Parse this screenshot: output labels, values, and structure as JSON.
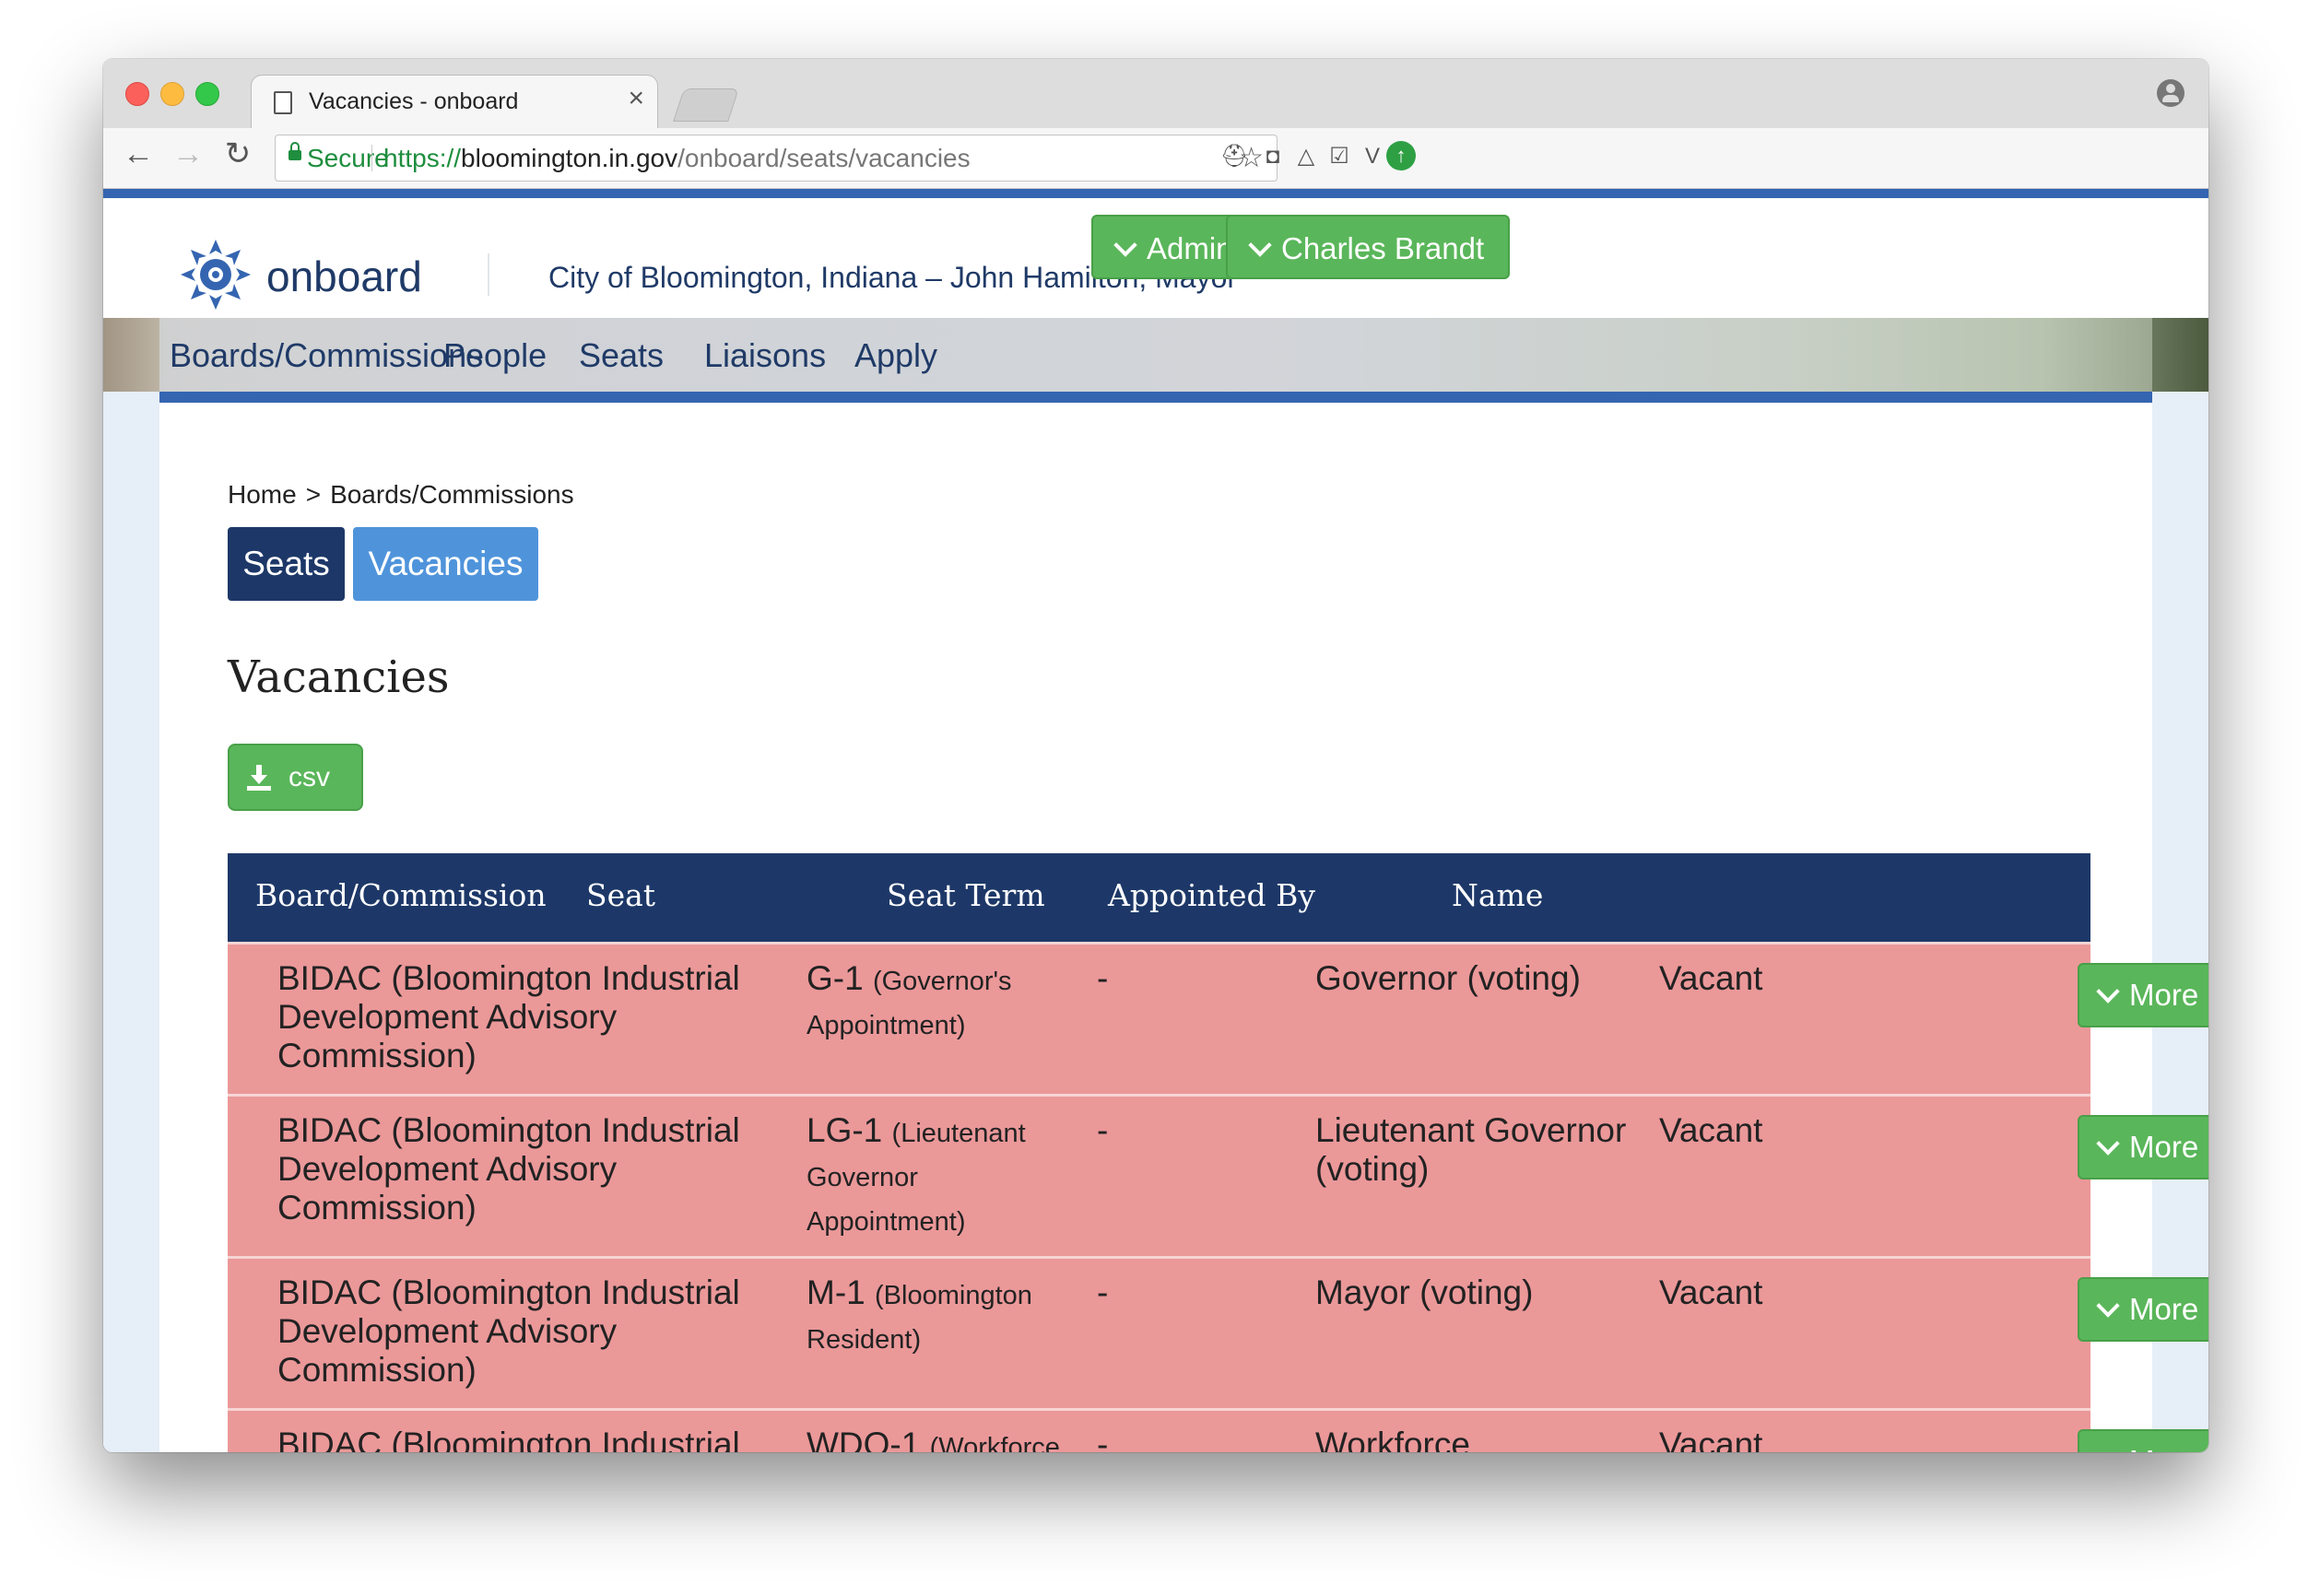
{
  "browser": {
    "tab_title": "Vacancies - onboard",
    "secure_label": "Secure",
    "url_scheme": "https://",
    "url_host": "bloomington.in.gov",
    "url_path": "/onboard/seats/vacancies"
  },
  "header": {
    "brand": "onboard",
    "city_title": "City of Bloomington, Indiana – John Hamilton, Mayor",
    "admin_label": "Admin",
    "user_label": "Charles Brandt"
  },
  "nav": {
    "items": [
      "Boards/Commissions",
      "People",
      "Seats",
      "Liaisons",
      "Apply"
    ]
  },
  "breadcrumb": {
    "home": "Home",
    "separator": ">",
    "current": "Boards/Commissions"
  },
  "subnav": {
    "seats": "Seats",
    "vacancies": "Vacancies"
  },
  "page_title": "Vacancies",
  "csv_label": "csv",
  "table": {
    "headers": [
      "Board/Commission",
      "Seat",
      "Seat Term",
      "Appointed By",
      "Name"
    ],
    "more_label": "More",
    "rows": [
      {
        "board": "BIDAC (Bloomington Industrial Development Advisory Commission)",
        "seat_code": "G-1",
        "seat_desc": "(Governor's Appointment)",
        "term": "-",
        "appointed_by": "Governor (voting)",
        "name": "Vacant"
      },
      {
        "board": "BIDAC (Bloomington Industrial Development Advisory Commission)",
        "seat_code": "LG-1",
        "seat_desc": "(Lieutenant Governor Appointment)",
        "term": "-",
        "appointed_by": "Lieutenant Governor (voting)",
        "name": "Vacant"
      },
      {
        "board": "BIDAC (Bloomington Industrial Development Advisory Commission)",
        "seat_code": "M-1",
        "seat_desc": "(Bloomington Resident)",
        "term": "-",
        "appointed_by": "Mayor (voting)",
        "name": "Vacant"
      },
      {
        "board": "BIDAC (Bloomington Industrial Development Advisory Commission)",
        "seat_code": "WDO-1",
        "seat_desc": "(Workforce",
        "term": "-",
        "appointed_by": "Workforce Development Off",
        "name": "Vacant"
      }
    ]
  },
  "colors": {
    "navy": "#1d3868",
    "accent_blue": "#3565b1",
    "light_blue": "#4f94db",
    "green": "#5ab65a",
    "vacancy_row": "#eb9899"
  }
}
